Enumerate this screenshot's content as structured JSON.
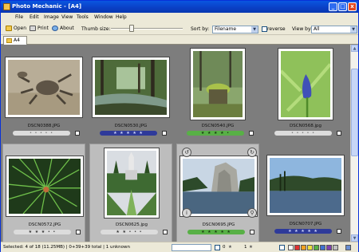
{
  "window": {
    "title": "Photo Mechanic - [A4]",
    "controls": [
      "_",
      "□",
      "x"
    ]
  },
  "menu": [
    "File",
    "Edit",
    "Image",
    "View",
    "Tools",
    "Window",
    "Help"
  ],
  "toolbar": {
    "open": "Open",
    "print": "Print",
    "about": "About",
    "thumb_size_label": "Thumb size:",
    "sort_by_label": "Sort by:",
    "sort_by_value": "Filename",
    "reverse_label": "reverse",
    "view_by_label": "View by:",
    "view_by_value": "All"
  },
  "tabs": [
    {
      "label": "A4"
    }
  ],
  "thumbnails": [
    {
      "filename": "DSCN0388.JPG",
      "stars": "• • • • •",
      "bar_color": "#dcdcdc",
      "selected": false,
      "scene": "crab"
    },
    {
      "filename": "DSCN0530.JPG",
      "stars": "★ ★ ★ ★ ★",
      "bar_color": "#2e3a9a",
      "selected": false,
      "scene": "forest-stream"
    },
    {
      "filename": "DSCN0540.JPG",
      "stars": "★ ★ ★ ★ •",
      "bar_color": "#58b046",
      "selected": false,
      "scene": "mossy-stump"
    },
    {
      "filename": "DSCN0568.jpg",
      "stars": "• • • • •",
      "bar_color": "#dcdcdc",
      "selected": false,
      "scene": "blue-flower"
    },
    {
      "filename": "DSCN0572.JPG",
      "stars": "★ ★ ★ • •",
      "bar_color": "#dcdcdc",
      "selected": true,
      "scene": "pine-needles"
    },
    {
      "filename": "DSCN0625.jpg",
      "stars": "★ ★ • • •",
      "bar_color": "#dcdcdc",
      "selected": true,
      "scene": "garden-fountain"
    },
    {
      "filename": "DSCN0695.JPG",
      "stars": "★ ★ ★ ★ ★",
      "bar_color": "#58b046",
      "selected": true,
      "scene": "rock-lake"
    },
    {
      "filename": "DSCN0707.JPG",
      "stars": "★ ★ ★ ★ ★",
      "bar_color": "#2e3a9a",
      "selected": false,
      "scene": "lake-shore"
    }
  ],
  "status": {
    "text": "Selected: 4 of 18 (11.25MB) | 0+39+39 total | 1 unknown",
    "tagged": "0",
    "star_count": "1",
    "colors": [
      "#ffffff",
      "#e03030",
      "#f0a020",
      "#f0e040",
      "#58b046",
      "#4070d0",
      "#8040b0",
      "#c0c0c0"
    ]
  }
}
